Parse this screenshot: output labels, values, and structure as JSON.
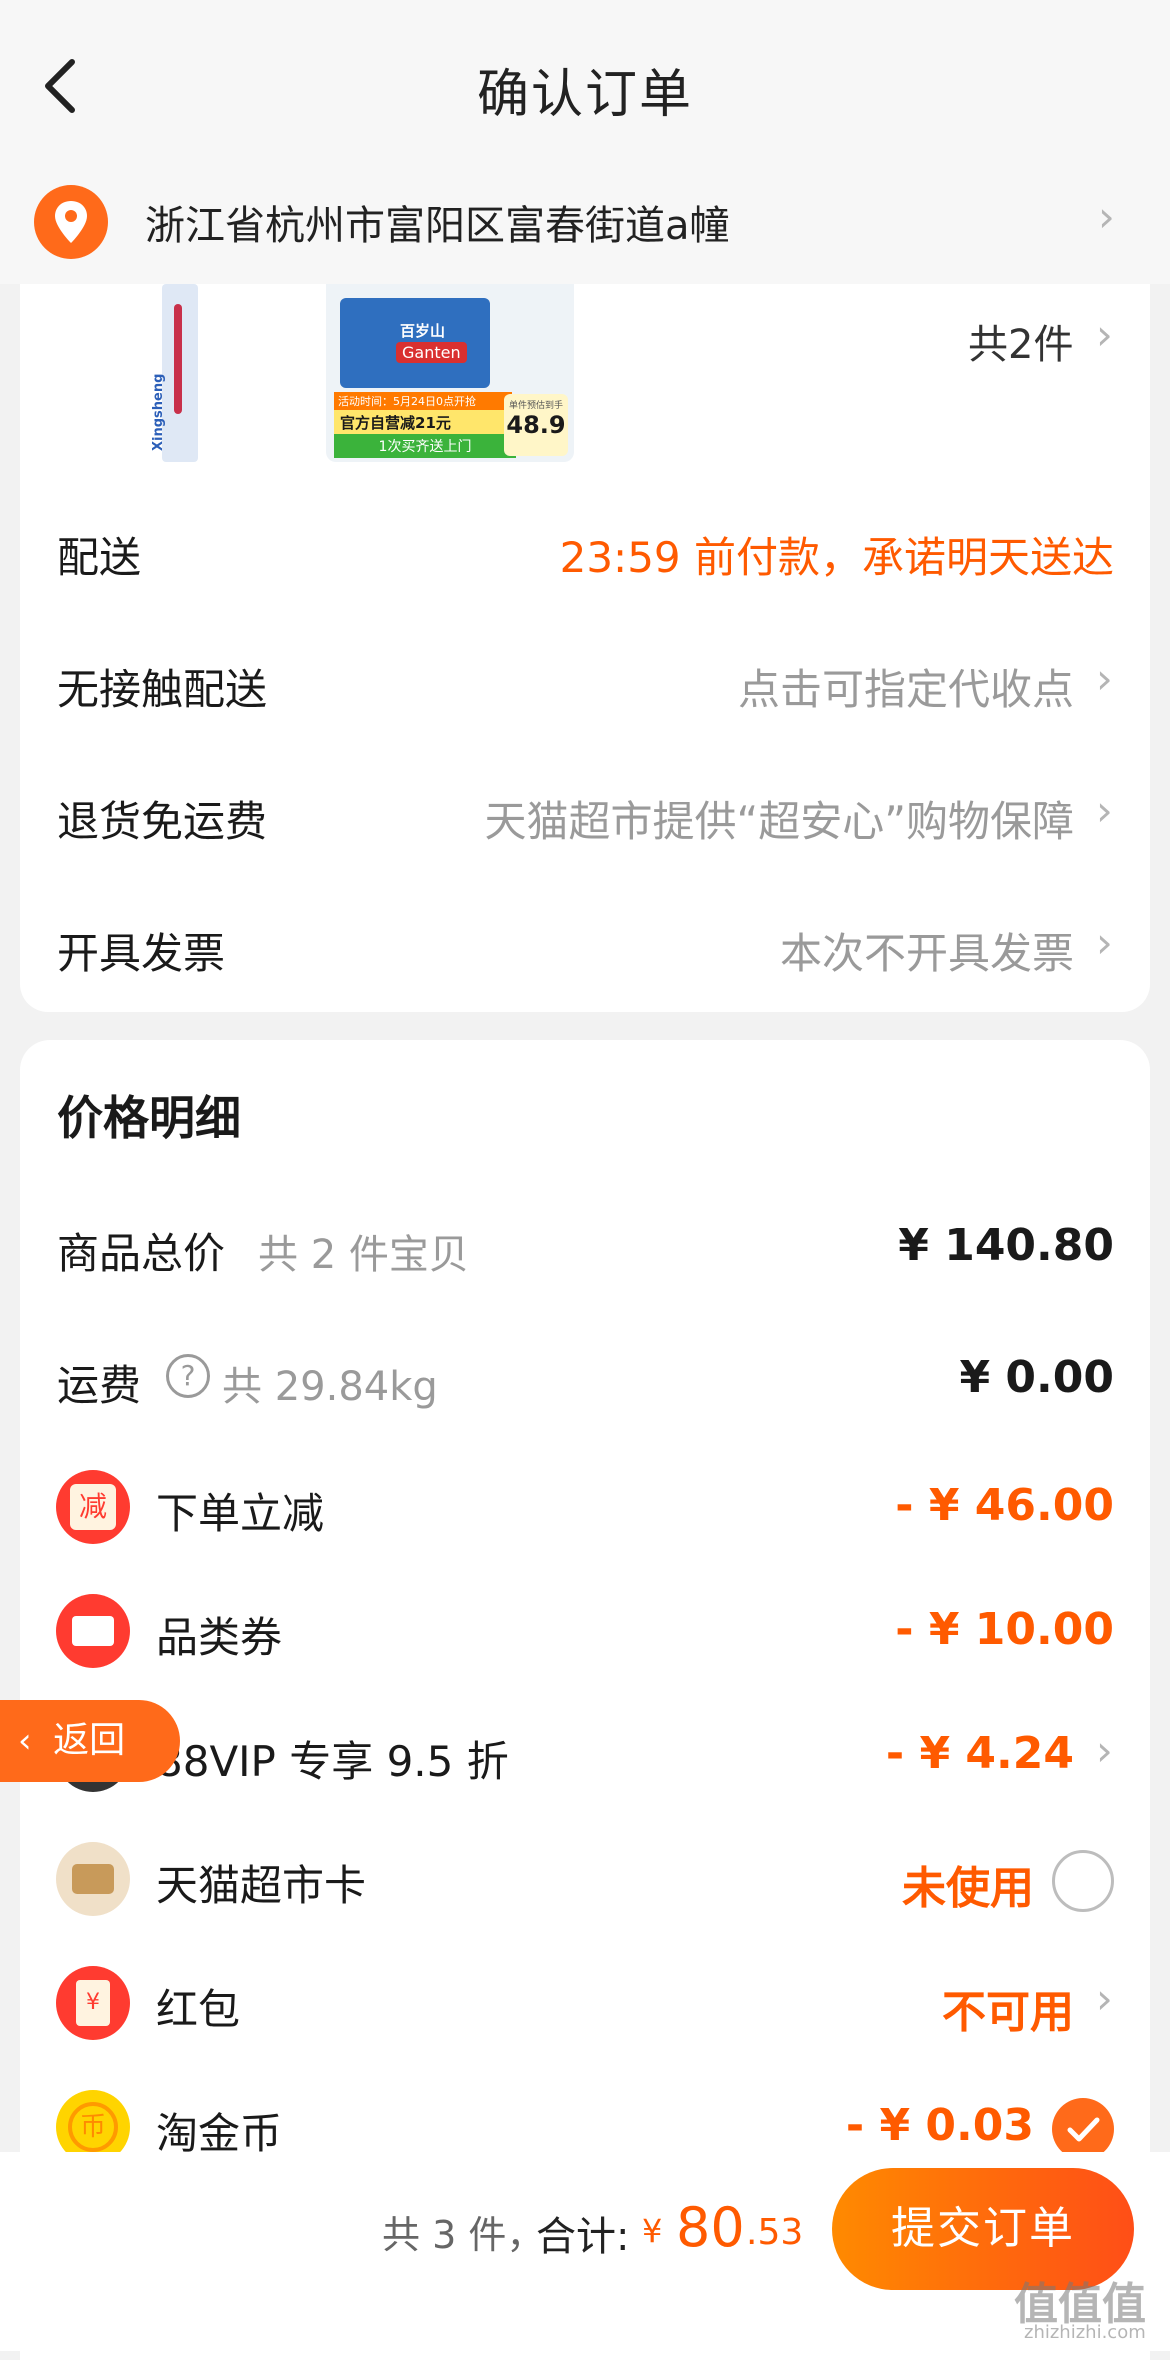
{
  "header": {
    "title": "确认订单"
  },
  "address": {
    "text": "浙江省杭州市富阳区富春街道a幢"
  },
  "items": {
    "count_label": "共2件",
    "product_box": {
      "brand_cn": "百岁山",
      "brand_en": "Ganten",
      "promo_tag": "活动时间：5月24日0点开抢",
      "promo_line1": "官方自营减21元",
      "promo_line2": "1次买齐送上门",
      "price_label": "单件预估到手",
      "price": "48.9"
    },
    "toothbrush_brand": "Xingsheng"
  },
  "order_options": [
    {
      "label": "配送",
      "value": "23:59 前付款，承诺明天送达",
      "style": "orange",
      "chevron": false
    },
    {
      "label": "无接触配送",
      "value": "点击可指定代收点",
      "style": "grey",
      "chevron": true
    },
    {
      "label": "退货免运费",
      "value": "天猫超市提供“超安心”购物保障",
      "style": "grey",
      "chevron": true
    },
    {
      "label": "开具发票",
      "value": "本次不开具发票",
      "style": "grey",
      "chevron": true
    }
  ],
  "price_detail": {
    "title": "价格明细",
    "subtotal": {
      "label": "商品总价",
      "sub": "共 2 件宝贝",
      "value": "¥ 140.80"
    },
    "shipping": {
      "label": "运费",
      "sub": "共 29.84kg",
      "value": "¥ 0.00"
    },
    "discounts": [
      {
        "label": "下单立减",
        "value": "- ¥ 46.00",
        "icon": "minus-coupon-icon",
        "icon_char": "减",
        "color": "#ff3b30"
      },
      {
        "label": "品类券",
        "value": "- ¥ 10.00",
        "icon": "ticket-icon",
        "icon_char": "",
        "color": "#ff3b30"
      },
      {
        "label": "88VIP 专享 9.5 折",
        "value": "- ¥ 4.24",
        "icon": "vip-icon",
        "icon_char": "",
        "color": "#333333"
      },
      {
        "label": "天猫超市卡",
        "value": "未使用",
        "icon": "card-icon",
        "icon_char": "",
        "color": "#f0e0c8"
      },
      {
        "label": "红包",
        "value": "不可用",
        "icon": "red-packet-icon",
        "icon_char": "¥",
        "color": "#ff3b30"
      },
      {
        "label": "淘金币",
        "value": "- ¥ 0.03",
        "icon": "coin-icon",
        "icon_char": "币",
        "color": "#ffd400"
      }
    ]
  },
  "float_back": {
    "label": "返回"
  },
  "footer": {
    "count": "共 3 件，",
    "total_label": "合计:",
    "currency": "¥",
    "total_int": "80",
    "total_dec": ".53",
    "submit_label": "提交订单"
  },
  "watermark": {
    "cn": "值值值",
    "en": "zhizhizhi.com"
  },
  "colors": {
    "accent": "#ff5a00",
    "pin": "#ff6a1a"
  }
}
